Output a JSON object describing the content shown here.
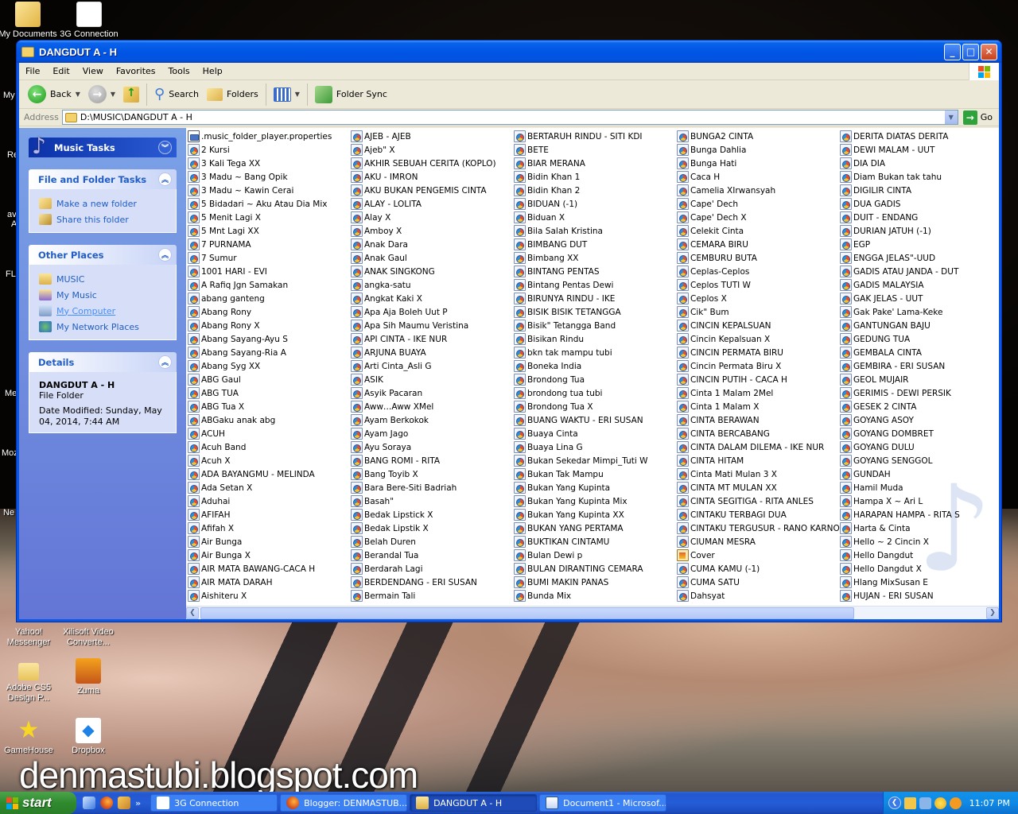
{
  "desktop": {
    "icons_top": [
      {
        "label": "My Documents",
        "icon": "my-documents-icon"
      },
      {
        "label": "3G Connection",
        "icon": "3g-connection-icon"
      }
    ],
    "icons_left_edge": [
      "My",
      "Re",
      "av",
      "A",
      "FL",
      "Me",
      "Moz",
      "Ne"
    ],
    "icons_bottom": [
      {
        "label": "Yahoo! Messenger",
        "icon": "yahoo-messenger-icon"
      },
      {
        "label": "Xilisoft Video Converte...",
        "icon": "xilisoft-icon"
      },
      {
        "label": "Adobe CS5 Design P...",
        "icon": "folder-icon"
      },
      {
        "label": "Zuma",
        "icon": "zuma-icon"
      },
      {
        "label": "GameHouse",
        "icon": "star-icon"
      },
      {
        "label": "Dropbox",
        "icon": "dropbox-icon"
      }
    ],
    "watermark": "denmastubi.blogspot.com"
  },
  "window": {
    "title": "DANGDUT A - H",
    "menu": [
      "File",
      "Edit",
      "View",
      "Favorites",
      "Tools",
      "Help"
    ],
    "toolbar": {
      "back": "Back",
      "search": "Search",
      "folders": "Folders",
      "folder_sync": "Folder Sync"
    },
    "address": {
      "label": "Address",
      "value": "D:\\MUSIC\\DANGDUT A - H",
      "go": "Go"
    },
    "taskpane": {
      "music_tasks": {
        "title": "Music Tasks"
      },
      "file_folder_tasks": {
        "title": "File and Folder Tasks",
        "items": [
          "Make a new folder",
          "Share this folder"
        ]
      },
      "other_places": {
        "title": "Other Places",
        "items": [
          "MUSIC",
          "My Music",
          "My Computer",
          "My Network Places"
        ]
      },
      "details": {
        "title": "Details",
        "name": "DANGDUT A - H",
        "type": "File Folder",
        "date": "Date Modified: Sunday, May 04, 2014, 7:44 AM"
      }
    },
    "files": [
      [
        ".music_folder_player.properties",
        "2 Kursi",
        "3 Kali Tega XX",
        "3 Madu ~ Bang Opik",
        "3 Madu ~ Kawin Cerai",
        "5 Bidadari ~ Aku Atau Dia Mix",
        "5 Menit Lagi X",
        "5 Mnt Lagi XX",
        "7 PURNAMA",
        "7 Sumur",
        "1001 HARI - EVI",
        "A Rafiq Jgn Samakan",
        "abang ganteng",
        "Abang Rony",
        "Abang Rony X",
        "Abang Sayang-Ayu S",
        "Abang Sayang-Ria A",
        "Abang Syg XX",
        "ABG Gaul",
        "ABG TUA",
        "ABG Tua X",
        "ABGaku anak abg",
        "ACUH",
        "Acuh Band",
        "Acuh X",
        "ADA BAYANGMU - MELINDA",
        "Ada Setan X",
        "Aduhai",
        "AFIFAH",
        "Afifah X",
        "Air Bunga",
        "Air Bunga X",
        "AIR MATA BAWANG-CACA H",
        "AIR MATA DARAH",
        "Aishiteru X"
      ],
      [
        "AJEB - AJEB",
        "Ajeb\" X",
        "AKHIR SEBUAH CERITA (KOPLO)",
        "AKU - IMRON",
        "AKU BUKAN PENGEMIS CINTA",
        "ALAY - LOLITA",
        "Alay X",
        "Amboy X",
        "Anak Dara",
        "Anak Gaul",
        "ANAK SINGKONG",
        "angka-satu",
        "Angkat Kaki X",
        "Apa Aja Boleh Uut P",
        "Apa Sih Maumu Veristina",
        "API CINTA - IKE NUR",
        "ARJUNA BUAYA",
        "Arti Cinta_Asli G",
        "ASIK",
        "Asyik Pacaran",
        "Aww…Aww XMel",
        "Ayam Berkokok",
        "Ayam Jago",
        "Ayu Soraya",
        "BANG ROMI - RITA",
        "Bang Toyib X",
        "Bara Bere-Siti Badriah",
        "Basah\"",
        "Bedak Lipstick X",
        "Bedak Lipstik X",
        "Belah Duren",
        "Berandal Tua",
        "Berdarah Lagi",
        "BERDENDANG - ERI SUSAN",
        "Bermain Tali"
      ],
      [
        "BERTARUH RINDU - SITI KDI",
        "BETE",
        "BIAR MERANA",
        "Bidin Khan 1",
        "Bidin Khan 2",
        "BIDUAN (-1)",
        "Biduan X",
        "Bila Salah Kristina",
        "BIMBANG DUT",
        "Bimbang XX",
        "BINTANG PENTAS",
        "Bintang Pentas Dewi",
        "BIRUNYA RINDU - IKE",
        "BISIK BISIK TETANGGA",
        "Bisik\" Tetangga Band",
        "Bisikan Rindu",
        "bkn tak mampu tubi",
        "Boneka India",
        "Brondong Tua",
        "brondong tua tubi",
        "Brondong Tua X",
        "BUANG WAKTU - ERI SUSAN",
        "Buaya Cinta",
        "Buaya Lina G",
        "Bukan Sekedar Mimpi_Tuti W",
        "Bukan Tak Mampu",
        "Bukan Yang Kupinta",
        "Bukan Yang Kupinta Mix",
        "Bukan Yang Kupinta XX",
        "BUKAN YANG PERTAMA",
        "BUKTIKAN CINTAMU",
        "Bulan Dewi p",
        "BULAN DIRANTING CEMARA",
        "BUMI MAKIN PANAS",
        "Bunda Mix"
      ],
      [
        "BUNGA2 CINTA",
        "Bunga Dahlia",
        "Bunga Hati",
        "Caca H",
        "Camelia XIrwansyah",
        "Cape' Dech",
        "Cape' Dech X",
        "Celekit Cinta",
        "CEMARA BIRU",
        "CEMBURU BUTA",
        "Ceplas-Ceplos",
        "Ceplos TUTI W",
        "Ceplos X",
        "Cik\" Bum",
        "CINCIN KEPALSUAN",
        "Cincin Kepalsuan X",
        "CINCIN PERMATA BIRU",
        "Cincin Permata Biru X",
        "CINCIN PUTIH - CACA H",
        "Cinta 1 Malam 2Mel",
        "Cinta 1 Malam X",
        "CINTA BERAWAN",
        "CINTA BERCABANG",
        "CINTA DALAM DILEMA - IKE NUR",
        "CINTA HITAM",
        "Cinta Mati Mulan 3 X",
        "CINTA MT MULAN  XX",
        "CINTA SEGITIGA - RITA ANLES",
        "CINTAKU TERBAGI DUA",
        "CINTAKU TERGUSUR - RANO KARNO",
        "CIUMAN MESRA",
        "Cover",
        "CUMA KAMU (-1)",
        "CUMA SATU",
        "Dahsyat"
      ],
      [
        "DERITA DIATAS DERITA",
        "DEWI MALAM - UUT",
        "DIA DIA",
        "Diam Bukan tak tahu",
        "DIGILIR CINTA",
        "DUA GADIS",
        "DUIT - ENDANG",
        "DURIAN JATUH (-1)",
        "EGP",
        "ENGGA JELAS\"-UUD",
        "GADIS ATAU JANDA - DUT",
        "GADIS MALAYSIA",
        "GAK JELAS - UUT",
        "Gak Pake' Lama-Keke",
        "GANTUNGAN BAJU",
        "GEDUNG TUA",
        "GEMBALA CINTA",
        "GEMBIRA - ERI SUSAN",
        "GEOL MUJAIR",
        "GERIMIS - DEWI PERSIK",
        "GESEK 2 CINTA",
        "GOYANG ASOY",
        "GOYANG DOMBRET",
        "GOYANG DULU",
        "GOYANG SENGGOL",
        "GUNDAH",
        "Hamil Muda",
        "Hampa X ~ Ari L",
        "HARAPAN HAMPA - RITA S",
        "Harta & Cinta",
        "Hello ~ 2 Cincin X",
        "Hello Dangdut",
        "Hello Dangdut X",
        "Hlang MixSusan E",
        "HUJAN - ERI SUSAN"
      ]
    ]
  },
  "taskbar": {
    "start": "start",
    "tasks": [
      {
        "label": "3G Connection",
        "icon": "3g-connection-icon",
        "active": false
      },
      {
        "label": "Blogger: DENMASTUB...",
        "icon": "firefox-icon",
        "active": false
      },
      {
        "label": "DANGDUT A - H",
        "icon": "folder-icon",
        "active": true
      },
      {
        "label": "Document1 - Microsof...",
        "icon": "word-icon",
        "active": false
      }
    ],
    "clock": "11:07 PM"
  }
}
